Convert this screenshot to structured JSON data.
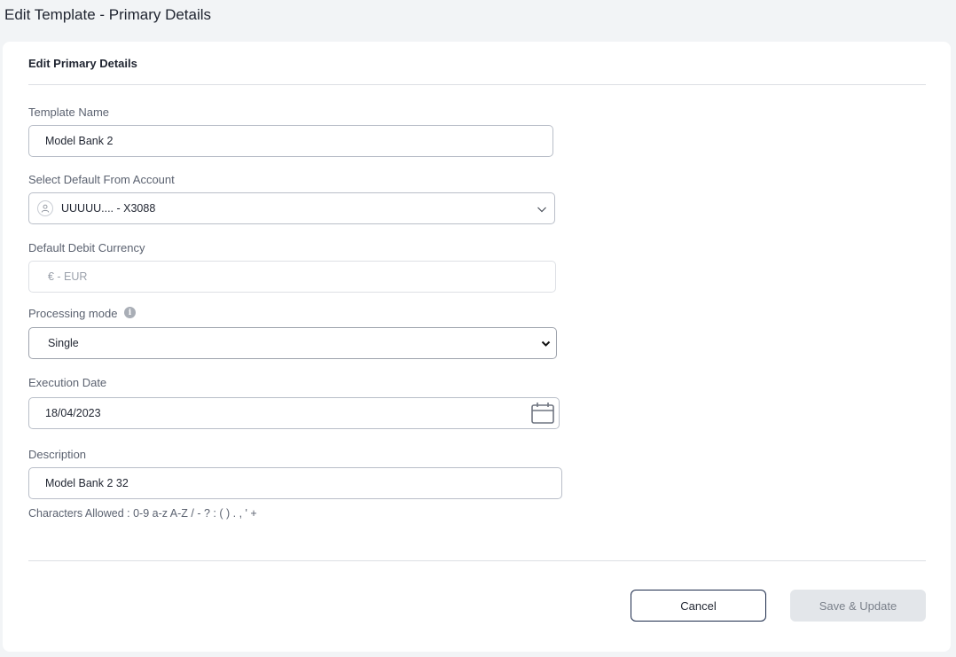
{
  "header": {
    "title": "Edit Template - Primary Details"
  },
  "form": {
    "section_title": "Edit Primary Details",
    "template_name": {
      "label": "Template Name",
      "value": "Model Bank 2"
    },
    "from_account": {
      "label": "Select Default From Account",
      "value": "UUUUU.... - X3088",
      "icon": "user-icon"
    },
    "debit_currency": {
      "label": "Default Debit Currency",
      "value": "€ - EUR",
      "disabled": true
    },
    "processing_mode": {
      "label": "Processing mode",
      "info_icon": "i",
      "value": "Single"
    },
    "execution_date": {
      "label": "Execution Date",
      "value": "18/04/2023",
      "icon": "calendar-icon"
    },
    "description": {
      "label": "Description",
      "value": "Model Bank 2 32",
      "help": "Characters Allowed : 0-9 a-z A-Z / - ? : ( ) . , ' +"
    }
  },
  "actions": {
    "cancel_label": "Cancel",
    "save_label": "Save & Update"
  },
  "colors": {
    "accent": "#1b2a4a",
    "disabled_button": "#e3e6ea",
    "background": "#f2f4f6"
  }
}
